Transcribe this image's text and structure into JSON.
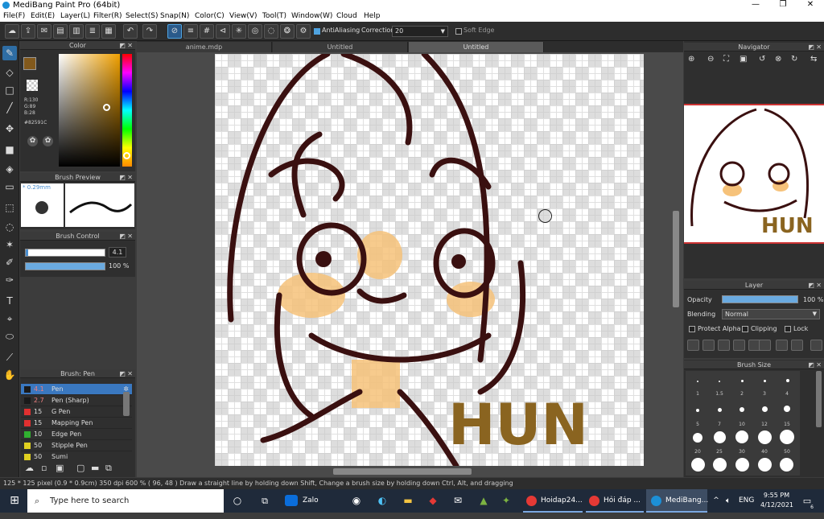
{
  "titlebar": {
    "title": "MediBang Paint Pro (64bit)",
    "minimize": "—",
    "maximize": "❐",
    "close": "✕"
  },
  "menu": [
    "File(F)",
    "Edit(E)",
    "Layer(L)",
    "Filter(R)",
    "Select(S)",
    "Snap(N)",
    "Color(C)",
    "View(V)",
    "Tool(T)",
    "Window(W)",
    "Cloud",
    "Help"
  ],
  "toolbar": {
    "antialiasing_label": "AntiAliasing",
    "correction_label": "Correction",
    "correction_value": "20",
    "soft_edge_label": "Soft Edge"
  },
  "color_panel": {
    "title": "Color",
    "r": "R:130",
    "g": "G:89",
    "b": "B:28",
    "hex": "#82591C",
    "fg_color": "#82591c",
    "bg_color": "#ffffff"
  },
  "brush_preview": {
    "title": "Brush Preview",
    "size": "* 0.29mm"
  },
  "brush_control": {
    "title": "Brush Control",
    "size_value": "4.1",
    "opacity_value": "100 %"
  },
  "brush_list": {
    "title": "Brush: Pen",
    "items": [
      {
        "num": "4.1",
        "name": "Pen",
        "color": "#1a1a1a",
        "selected": true
      },
      {
        "num": "2.7",
        "name": "Pen (Sharp)",
        "color": "#1a1a1a"
      },
      {
        "num": "15",
        "name": "G Pen",
        "color": "#e03030"
      },
      {
        "num": "15",
        "name": "Mapping Pen",
        "color": "#e03030"
      },
      {
        "num": "10",
        "name": "Edge Pen",
        "color": "#30b030"
      },
      {
        "num": "50",
        "name": "Stipple Pen",
        "color": "#e0d020"
      },
      {
        "num": "50",
        "name": "Sumi",
        "color": "#e0d020"
      }
    ]
  },
  "tabs": [
    "anime.mdp",
    "Untitled",
    "Untitled"
  ],
  "canvas": {
    "signature": "HUN"
  },
  "navigator": {
    "title": "Navigator",
    "preview_text": "HUN"
  },
  "layer": {
    "title": "Layer",
    "opacity_label": "Opacity",
    "opacity_value": "100 %",
    "blending_label": "Blending",
    "blending_value": "Normal",
    "protect_alpha": "Protect Alpha",
    "clipping": "Clipping",
    "lock": "Lock"
  },
  "brush_size": {
    "title": "Brush Size",
    "sizes": [
      "1",
      "1.5",
      "2",
      "3",
      "4",
      "5",
      "7",
      "10",
      "12",
      "15",
      "20",
      "25",
      "30",
      "40",
      "50",
      "",
      "",
      "",
      "",
      ""
    ]
  },
  "status": {
    "text": "125 * 125 pixel  (0.9 * 0.9cm)  350 dpi  600 %  ( 96, 48 )  Draw a straight line by holding down Shift, Change a brush size by holding down Ctrl, Alt, and dragging"
  },
  "taskbar": {
    "search_placeholder": "Type here to search",
    "apps": [
      "Zalo",
      "Hoidap24...",
      "Hỏi đáp ...",
      "MediBang..."
    ],
    "lang": "ENG",
    "time": "9:55 PM",
    "date": "4/12/2021",
    "notif": "6"
  }
}
